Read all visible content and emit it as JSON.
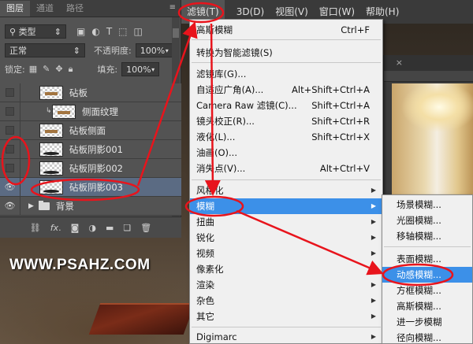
{
  "watermark": "WWW.PSAHZ.COM",
  "layers_panel": {
    "tabs": [
      "图层",
      "通道",
      "路径"
    ],
    "filter_kind": "类型",
    "blend_mode": "正常",
    "opacity_label": "不透明度:",
    "opacity_value": "100%",
    "lock_label": "锁定:",
    "fill_label": "填充:",
    "fill_value": "100%",
    "layers": [
      {
        "name": "砧板",
        "visible": false,
        "selected": false
      },
      {
        "name": "侧面纹理",
        "visible": false,
        "selected": false,
        "clipped": true
      },
      {
        "name": "砧板侧面",
        "visible": false,
        "selected": false
      },
      {
        "name": "砧板阴影001",
        "visible": false,
        "selected": false
      },
      {
        "name": "砧板阴影002",
        "visible": false,
        "selected": false
      },
      {
        "name": "砧板阴影003",
        "visible": true,
        "selected": true
      },
      {
        "name": "背景",
        "visible": true,
        "selected": false,
        "group": true
      }
    ],
    "footer_icons": [
      "link-icon",
      "fx-icon",
      "mask-icon",
      "adjustment-icon",
      "folder-icon",
      "new-layer-icon",
      "trash-icon"
    ]
  },
  "menubar": {
    "items": [
      "滤镜(T)",
      "3D(D)",
      "视图(V)",
      "窗口(W)",
      "帮助(H)"
    ],
    "active_index": 0
  },
  "filter_menu": {
    "items": [
      {
        "label": "高斯模糊",
        "shortcut": "Ctrl+F"
      },
      {
        "sep": true
      },
      {
        "label": "转换为智能滤镜(S)",
        "shortcut": ""
      },
      {
        "sep": true
      },
      {
        "label": "滤镜库(G)...",
        "shortcut": ""
      },
      {
        "label": "自适应广角(A)...",
        "shortcut": "Alt+Shift+Ctrl+A"
      },
      {
        "label": "Camera Raw 滤镜(C)...",
        "shortcut": "Shift+Ctrl+A"
      },
      {
        "label": "镜头校正(R)...",
        "shortcut": "Shift+Ctrl+R"
      },
      {
        "label": "液化(L)...",
        "shortcut": "Shift+Ctrl+X"
      },
      {
        "label": "油画(O)...",
        "shortcut": ""
      },
      {
        "label": "消失点(V)...",
        "shortcut": "Alt+Ctrl+V"
      },
      {
        "sep": true
      },
      {
        "label": "风格化",
        "shortcut": "",
        "submenu": true
      },
      {
        "label": "模糊",
        "shortcut": "",
        "submenu": true,
        "highlighted": true
      },
      {
        "label": "扭曲",
        "shortcut": "",
        "submenu": true
      },
      {
        "label": "锐化",
        "shortcut": "",
        "submenu": true
      },
      {
        "label": "视频",
        "shortcut": "",
        "submenu": true
      },
      {
        "label": "像素化",
        "shortcut": "",
        "submenu": true
      },
      {
        "label": "渲染",
        "shortcut": "",
        "submenu": true
      },
      {
        "label": "杂色",
        "shortcut": "",
        "submenu": true
      },
      {
        "label": "其它",
        "shortcut": "",
        "submenu": true
      },
      {
        "sep": true
      },
      {
        "label": "Digimarc",
        "shortcut": "",
        "submenu": true
      }
    ]
  },
  "blur_submenu": {
    "items": [
      {
        "label": "场景模糊..."
      },
      {
        "label": "光圈模糊..."
      },
      {
        "label": "移轴模糊..."
      },
      {
        "sep": true
      },
      {
        "label": "表面模糊..."
      },
      {
        "label": "动感模糊...",
        "highlighted": true
      },
      {
        "label": "方框模糊..."
      },
      {
        "label": "高斯模糊..."
      },
      {
        "label": "进一步模糊"
      },
      {
        "label": "径向模糊..."
      }
    ]
  },
  "colors": {
    "highlight": "#3c90e8",
    "annotation": "#e8141c",
    "selected_layer": "#5b6b83"
  }
}
